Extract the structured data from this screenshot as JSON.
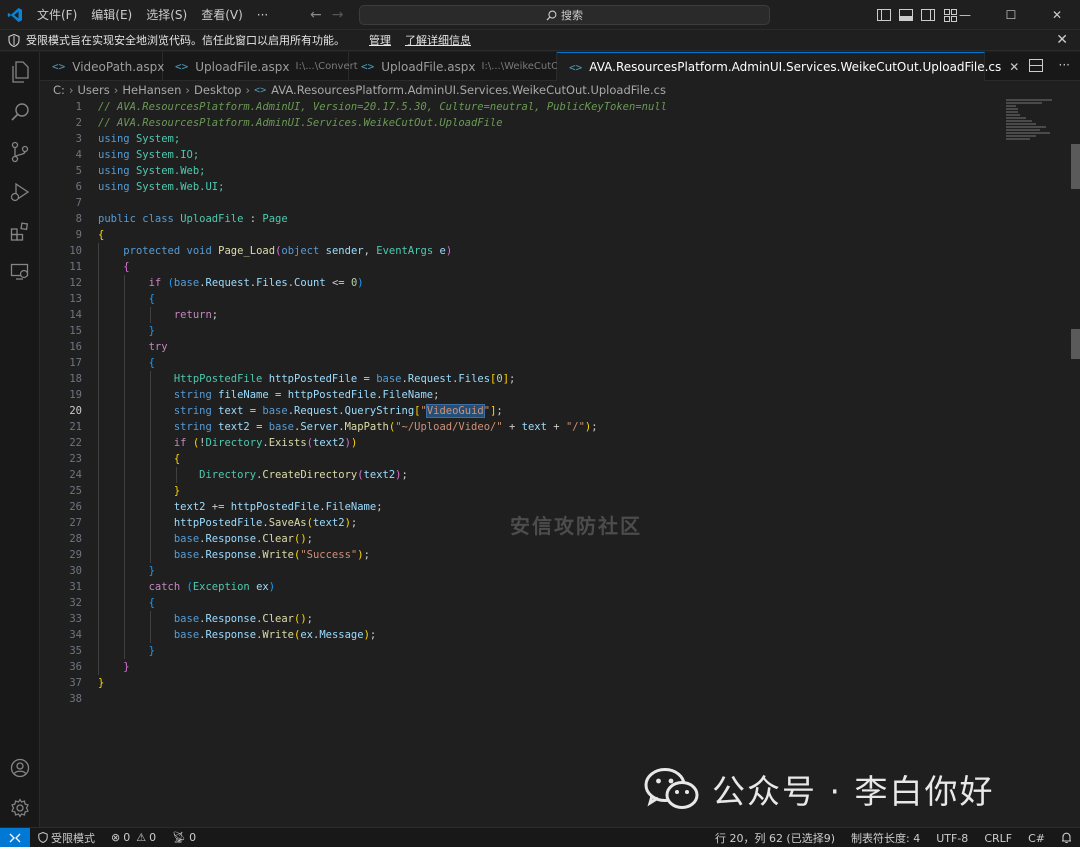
{
  "menu": [
    "文件(F)",
    "编辑(E)",
    "选择(S)",
    "查看(V)",
    "···"
  ],
  "search": {
    "label": "搜索"
  },
  "banner": {
    "text": "受限模式旨在实现安全地浏览代码。信任此窗口以启用所有功能。",
    "manage": "管理",
    "learn_more": "了解详细信息"
  },
  "tabs": [
    {
      "name": "VideoPath.aspx",
      "path": ""
    },
    {
      "name": "UploadFile.aspx",
      "path": "I:\\...\\Convert"
    },
    {
      "name": "UploadFile.aspx",
      "path": "I:\\...\\WeikeCutOut"
    },
    {
      "name": "AVA.ResourcesPlatform.AdminUI.Services.WeikeCutOut.UploadFile.cs",
      "path": ""
    }
  ],
  "breadcrumb": [
    "C:",
    "Users",
    "HeHansen",
    "Desktop",
    "AVA.ResourcesPlatform.AdminUI.Services.WeikeCutOut.UploadFile.cs"
  ],
  "code": {
    "line_numbers": [
      "1",
      "2",
      "3",
      "4",
      "5",
      "6",
      "7",
      "8",
      "9",
      "10",
      "11",
      "12",
      "13",
      "14",
      "15",
      "16",
      "17",
      "18",
      "19",
      "20",
      "21",
      "22",
      "23",
      "24",
      "25",
      "26",
      "27",
      "28",
      "29",
      "30",
      "31",
      "32",
      "33",
      "34",
      "35",
      "36",
      "37",
      "38"
    ],
    "current_line": "20",
    "comment1": "// AVA.ResourcesPlatform.AdminUI, Version=20.17.5.30, Culture=neutral, PublicKeyToken=null",
    "comment2": "// AVA.ResourcesPlatform.AdminUI.Services.WeikeCutOut.UploadFile",
    "kw_using": "using",
    "ns_system": "System;",
    "ns_io": "System.IO;",
    "ns_web": "System.Web;",
    "ns_webui": "System.Web.UI;",
    "kw_public": "public",
    "kw_class": "class",
    "cls_uploadfile": "UploadFile",
    "colon": ":",
    "cls_page": "Page",
    "kw_protected": "protected",
    "kw_void": "void",
    "fn_page_load": "Page_Load",
    "sig_rest_1": "(",
    "kw_object": "object",
    "p_sender": "sender",
    "comma": ",",
    "t_eventargs": "EventArgs",
    "p_e": "e",
    "close_paren": ")",
    "kw_if": "if",
    "if_cond_1": "(",
    "kw_base": "base",
    "dot": ".",
    "request": "Request",
    "files": "Files",
    "count": "Count",
    "le": "<=",
    "zero": "0",
    "kw_return": "return",
    "semi": ";",
    "kw_try": "try",
    "t_httppostedfile": "HttpPostedFile",
    "v_httppostedfile": "httpPostedFile",
    "eq": "=",
    "idx0": "0",
    "kw_string": "string",
    "v_filename": "fileName",
    "filename_prop": "FileName",
    "v_text": "text",
    "querystring": "QueryString",
    "s_videoguid": "VideoGuid",
    "v_text2": "text2",
    "server": "Server",
    "mappath": "MapPath",
    "s_path": "\"~/Upload/Video/\"",
    "plus": "+",
    "s_slash": "\"/\"",
    "not": "!",
    "t_directory": "Directory",
    "exists": "Exists",
    "createdirectory": "CreateDirectory",
    "pluseq": "+=",
    "saveas": "SaveAs",
    "response": "Response",
    "clear": "Clear",
    "write": "Write",
    "s_success": "\"Success\"",
    "kw_catch": "catch",
    "t_exception": "Exception",
    "v_ex": "ex",
    "message": "Message",
    "brace_open": "{",
    "brace_close": "}"
  },
  "watermarks": {
    "center": "安信攻防社区",
    "wechat": "公众号 · 李白你好"
  },
  "status": {
    "restricted": "受限模式",
    "errors": "0",
    "warnings": "0",
    "ports": "0",
    "position": "行 20，列 62 (已选择9)",
    "indent": "制表符长度: 4",
    "encoding": "UTF-8",
    "eol": "CRLF",
    "language": "C#"
  },
  "colors": {
    "accent": "#0078d4",
    "editor_bg": "#1f1f1f",
    "sidebar_bg": "#181818"
  }
}
